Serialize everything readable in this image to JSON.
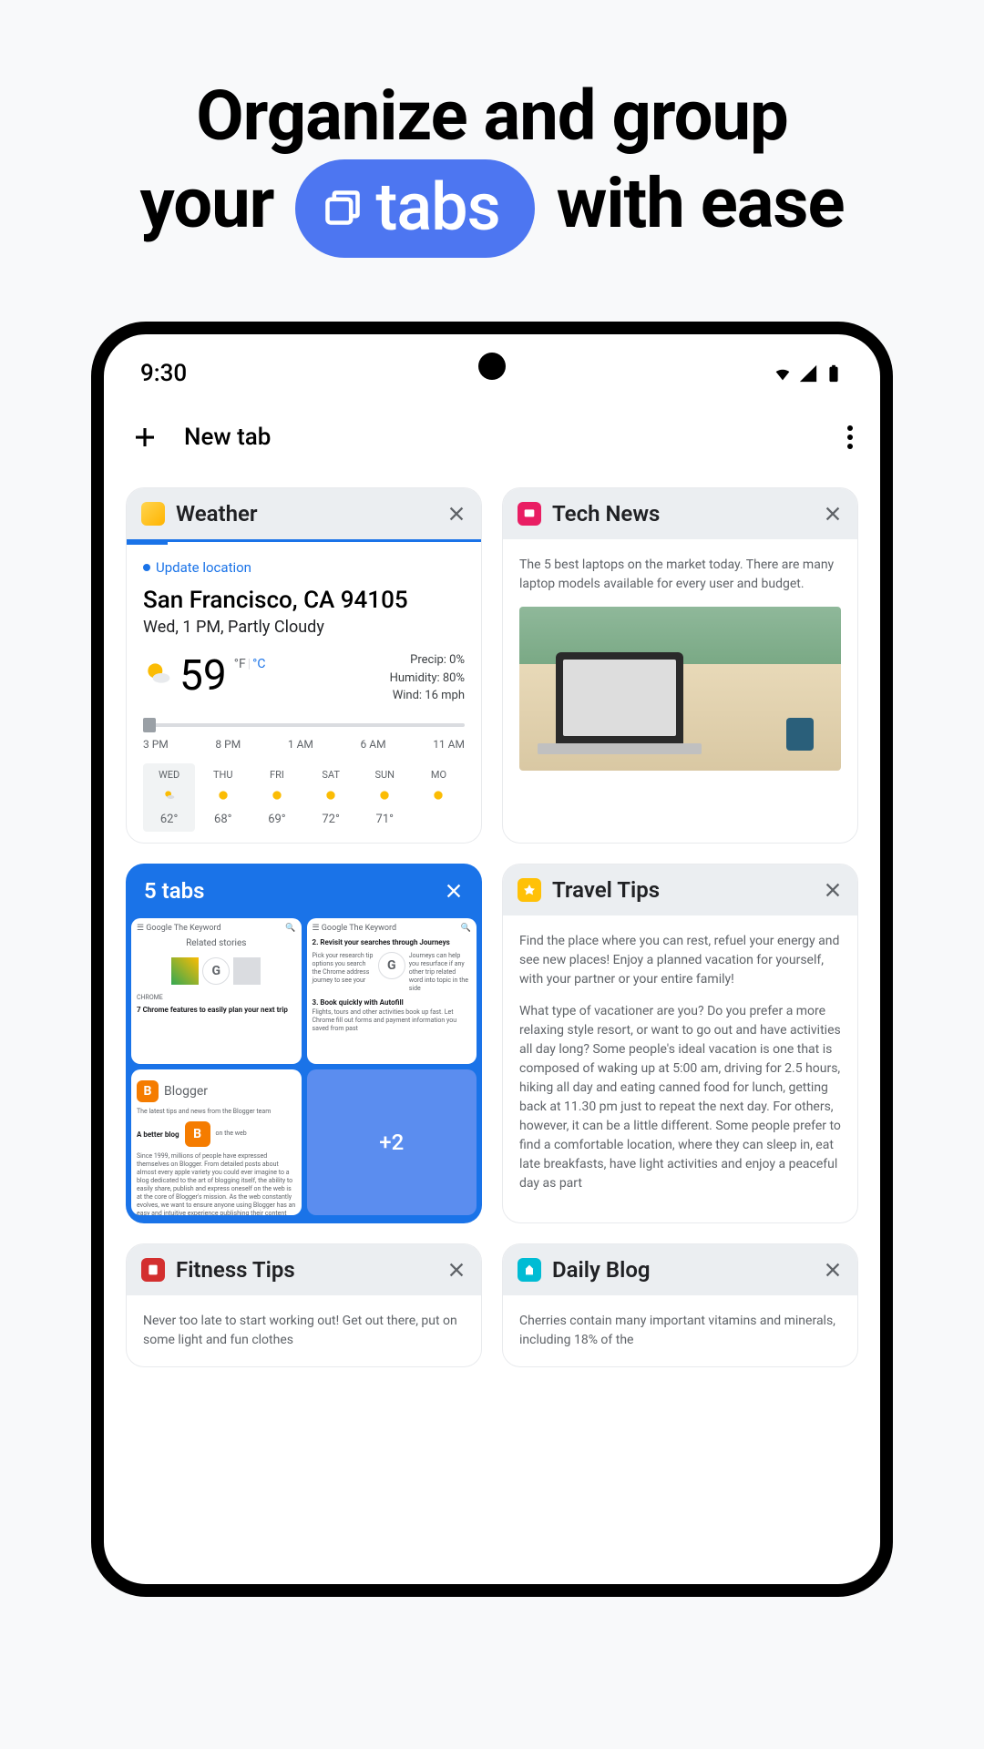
{
  "hero": {
    "line1": "Organize and group",
    "your": "your",
    "pill_text": "tabs",
    "with_ease": "with ease"
  },
  "status": {
    "time": "9:30"
  },
  "toolbar": {
    "title": "New tab"
  },
  "tabs": {
    "weather": {
      "title": "Weather",
      "update": "Update location",
      "city": "San Francisco, CA 94105",
      "subtitle": "Wed, 1 PM, Partly Cloudy",
      "temp": "59",
      "unit_f": "°F",
      "unit_c": "°C",
      "precip": "Precip: 0%",
      "humidity": "Humidity: 80%",
      "wind": "Wind: 16 mph",
      "hours": [
        "3 PM",
        "8 PM",
        "1 AM",
        "6 AM",
        "11 AM"
      ],
      "forecast": [
        {
          "day": "WED",
          "temp": "62°"
        },
        {
          "day": "THU",
          "temp": "68°"
        },
        {
          "day": "FRI",
          "temp": "69°"
        },
        {
          "day": "SAT",
          "temp": "72°"
        },
        {
          "day": "SUN",
          "temp": "71°"
        },
        {
          "day": "MO",
          "temp": ""
        }
      ]
    },
    "tech": {
      "title": "Tech News",
      "body": "The 5 best laptops on the market today. There are many laptop models available for every user and budget."
    },
    "group": {
      "title": "5 tabs",
      "related": "Related stories",
      "chrome_label": "CHROME",
      "feature1": "7 Chrome features to easily plan your next trip",
      "step2": "2. Revisit your searches through Journeys",
      "step3": "3. Book quickly with Autofill",
      "blogger": "Blogger",
      "blogger_sub": "A better blog",
      "overflow": "+2"
    },
    "travel": {
      "title": "Travel Tips",
      "p1": "Find the place where you can rest, refuel your energy and see new places! Enjoy a planned vacation for yourself, with your partner or your entire family!",
      "p2": "What type of vacationer are you? Do you prefer a more relaxing style resort, or want to go out and have activities all day long? Some people's ideal vacation is one that is composed of waking up at 5:00 am, driving for 2.5 hours, hiking all day and eating canned food for lunch, getting back at 11.30 pm just to repeat the next day. For others, however, it can be a little different. Some people prefer to find a comfortable location, where they can sleep in, eat late breakfasts, have light activities and enjoy a peaceful day as part"
    },
    "fitness": {
      "title": "Fitness Tips",
      "body": "Never too late to start working out! Get out there, put on some light and fun clothes"
    },
    "daily": {
      "title": "Daily Blog",
      "body": "Cherries contain many important vitamins and minerals, including 18% of the"
    }
  }
}
